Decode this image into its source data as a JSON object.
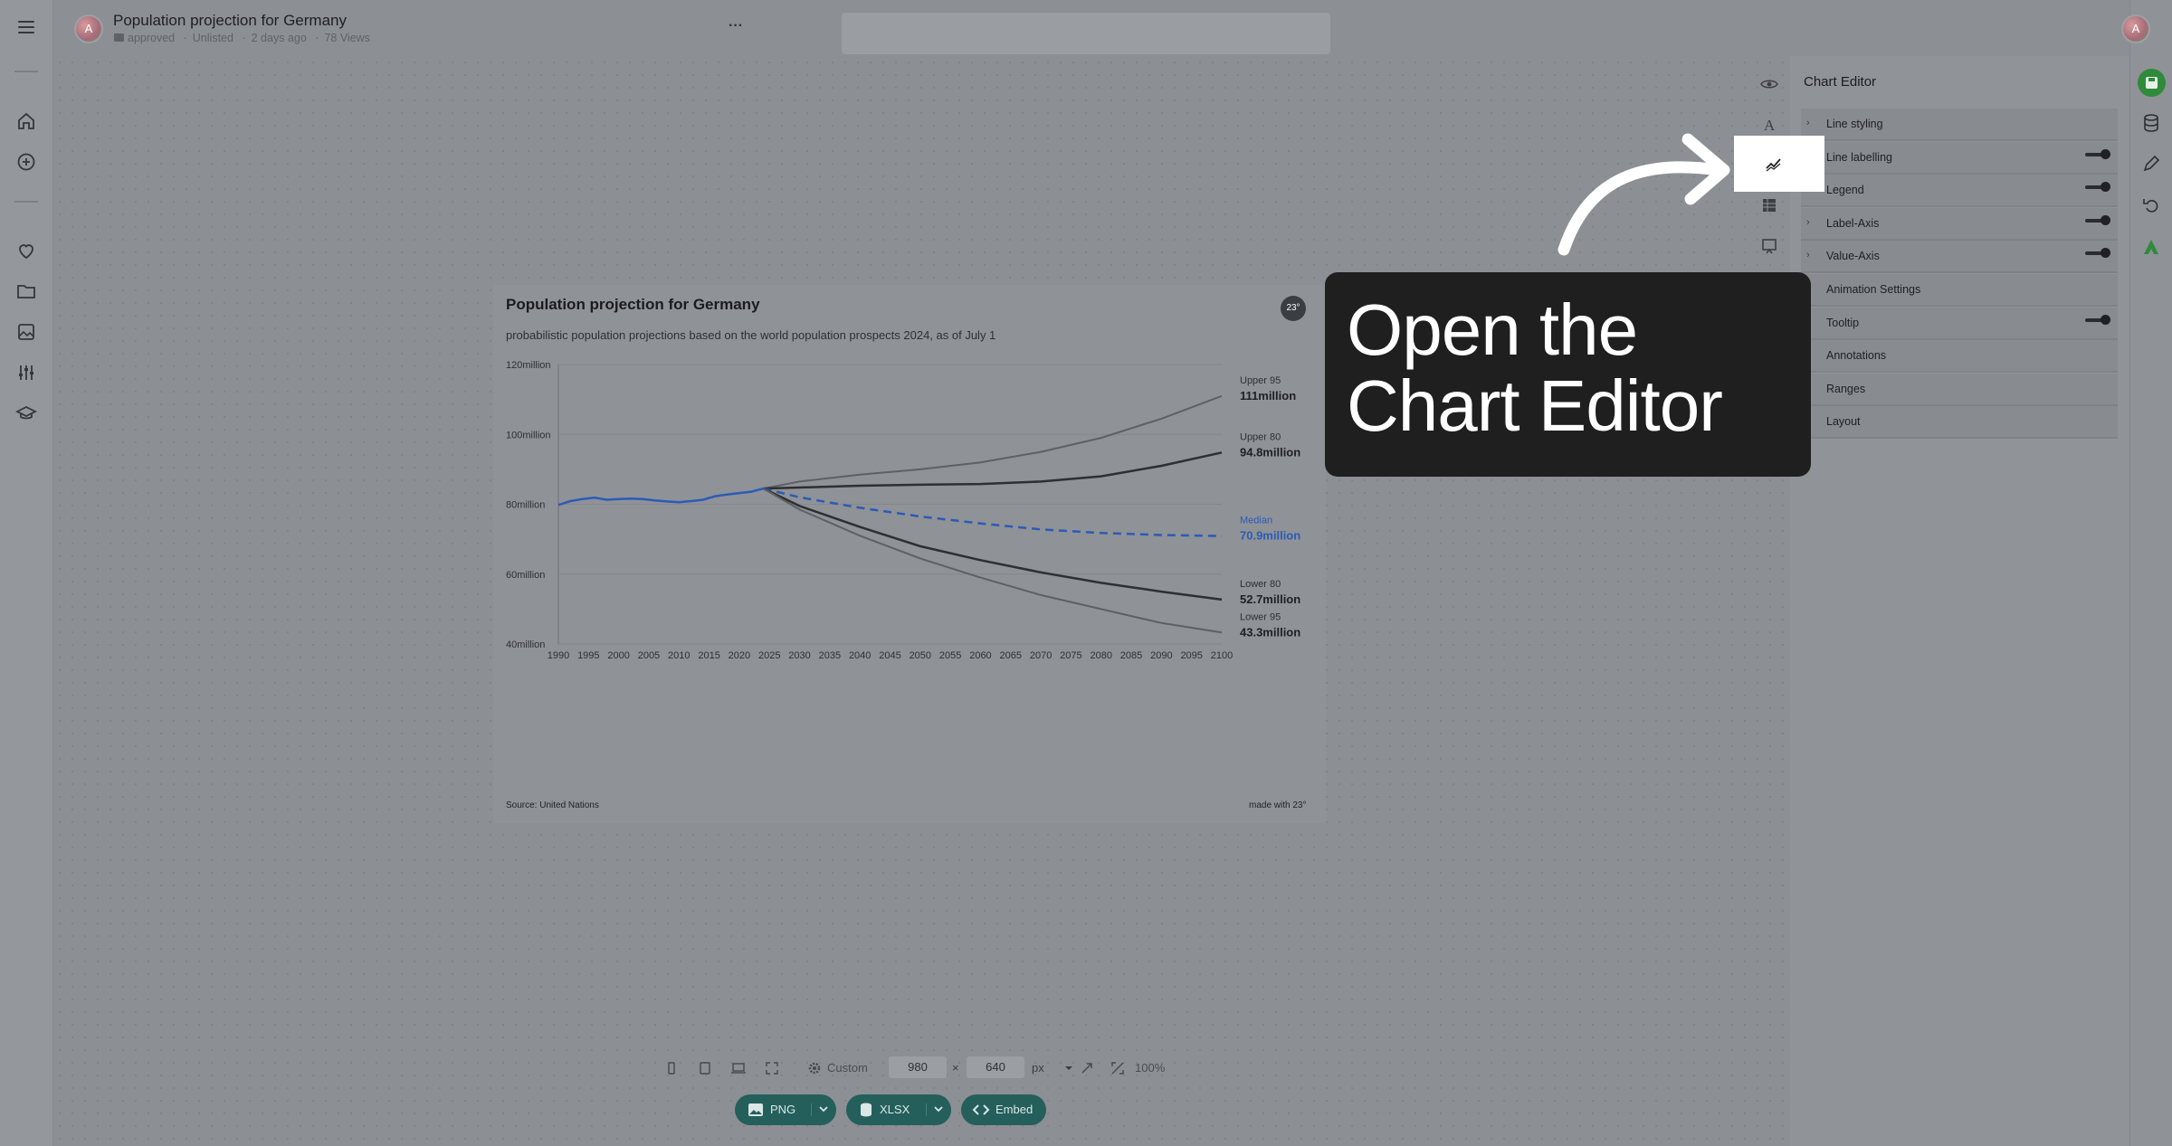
{
  "header": {
    "title": "Population projection for Germany",
    "avatar_letter": "A",
    "status": "approved",
    "visibility": "Unlisted",
    "time": "2 days ago",
    "views": "78 Views",
    "more_label": "···",
    "user_avatar_letter": "A"
  },
  "sidebar": {
    "items": [
      "menu-icon",
      "home-icon",
      "add-circle-icon",
      "heart-icon",
      "folder-icon",
      "image-icon",
      "sliders-icon",
      "graduation-cap-icon"
    ]
  },
  "chart_card": {
    "title": "Population projection for Germany",
    "subtitle": "probabilistic population projections based on the world population prospects 2024, as of July 1",
    "source": "Source: United Nations",
    "made_with": "made with 23°",
    "logo_text": "23°"
  },
  "chart_data": {
    "type": "line",
    "title": "Population projection for Germany",
    "subtitle": "probabilistic population projections based on the world population prospects 2024, as of July 1",
    "ylim": [
      40,
      120
    ],
    "y_ticks": [
      "120million",
      "100million",
      "80million",
      "60million",
      "40million"
    ],
    "y_tick_values": [
      120,
      100,
      80,
      60,
      40
    ],
    "x_ticks": [
      "1990",
      "1995",
      "2000",
      "2005",
      "2010",
      "2015",
      "2020",
      "2025",
      "2030",
      "2035",
      "2040",
      "2045",
      "2050",
      "2055",
      "2060",
      "2065",
      "2070",
      "2075",
      "2080",
      "2085",
      "2090",
      "2095",
      "2100"
    ],
    "xlim": [
      1990,
      2100
    ],
    "historical": {
      "color": "#2b5bb7",
      "x": [
        1990,
        1992,
        1994,
        1996,
        1998,
        2000,
        2002,
        2004,
        2006,
        2008,
        2010,
        2012,
        2014,
        2016,
        2018,
        2020,
        2022,
        2024
      ],
      "y": [
        79.8,
        80.9,
        81.5,
        81.9,
        81.3,
        81.5,
        81.6,
        81.5,
        81.1,
        80.8,
        80.6,
        80.9,
        81.3,
        82.3,
        82.8,
        83.2,
        83.6,
        84.5
      ]
    },
    "series": [
      {
        "name": "Upper 95",
        "value_label": "111million",
        "color": "#5e6064",
        "width": 2,
        "x": [
          2024,
          2030,
          2040,
          2050,
          2060,
          2070,
          2080,
          2090,
          2100
        ],
        "y": [
          84.5,
          86.5,
          88.5,
          90,
          92,
          95,
          99,
          104.5,
          111
        ]
      },
      {
        "name": "Upper 80",
        "value_label": "94.8million",
        "color": "#2d2f32",
        "width": 2.5,
        "x": [
          2024,
          2030,
          2040,
          2050,
          2060,
          2070,
          2080,
          2090,
          2100
        ],
        "y": [
          84.5,
          84.8,
          85.3,
          85.6,
          85.8,
          86.5,
          88,
          91,
          94.8
        ]
      },
      {
        "name": "Median",
        "value_label": "70.9million",
        "color": "#2b5bb7",
        "dashed": true,
        "width": 2.5,
        "x": [
          2024,
          2030,
          2040,
          2050,
          2060,
          2070,
          2080,
          2090,
          2100
        ],
        "y": [
          84.5,
          82,
          79,
          76.5,
          74.5,
          72.8,
          71.8,
          71.2,
          70.9
        ]
      },
      {
        "name": "Lower 80",
        "value_label": "52.7million",
        "color": "#2d2f32",
        "width": 2.5,
        "x": [
          2024,
          2030,
          2040,
          2050,
          2060,
          2070,
          2080,
          2090,
          2100
        ],
        "y": [
          84.5,
          79.5,
          73.5,
          68,
          64,
          60.5,
          57.5,
          55,
          52.7
        ]
      },
      {
        "name": "Lower 95",
        "value_label": "43.3million",
        "color": "#5e6064",
        "width": 2,
        "x": [
          2024,
          2030,
          2040,
          2050,
          2060,
          2070,
          2080,
          2090,
          2100
        ],
        "y": [
          84.5,
          78.5,
          71,
          64.5,
          59,
          54,
          50,
          46,
          43.3
        ]
      }
    ]
  },
  "toolbar": {
    "preset_label": "Custom",
    "width_value": "980",
    "times_label": "×",
    "height_value": "640",
    "unit_label": "px",
    "zoom_label": "100%",
    "export_png": "PNG",
    "export_xlsx": "XLSX",
    "export_embed": "Embed"
  },
  "editor": {
    "title": "Chart Editor",
    "sections": [
      {
        "label": "Line styling",
        "toggle": false
      },
      {
        "label": "Line labelling",
        "toggle": true
      },
      {
        "label": "Legend",
        "toggle": true
      },
      {
        "label": "Label-Axis",
        "toggle": true
      },
      {
        "label": "Value-Axis",
        "toggle": true
      },
      {
        "label": "Animation Settings",
        "toggle": false
      },
      {
        "label": "Tooltip",
        "toggle": true
      },
      {
        "label": "Annotations",
        "toggle": false
      },
      {
        "label": "Ranges",
        "toggle": false
      },
      {
        "label": "Layout",
        "toggle": false
      }
    ]
  },
  "callout": {
    "line1": "Open the",
    "line2": "Chart Editor"
  },
  "colors": {
    "overlay": "#8c8f93",
    "accent_green": "#2f8a3c",
    "teal": "#245f5b",
    "callout_bg": "#1f1f1f"
  }
}
